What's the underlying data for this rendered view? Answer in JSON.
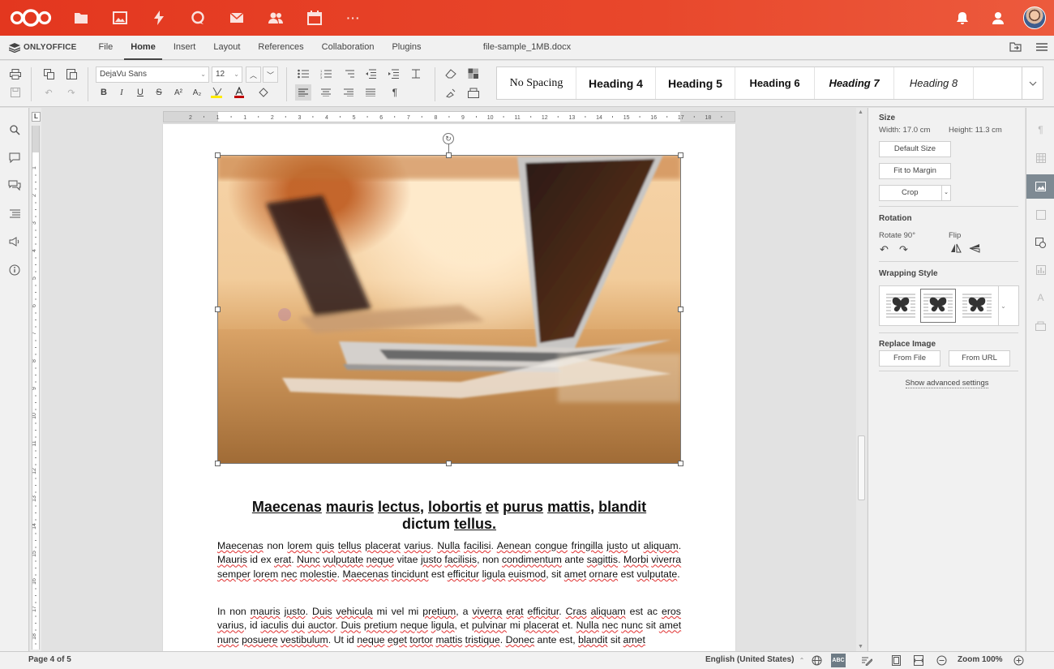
{
  "nextcloud": {
    "apps": [
      "files-icon",
      "photos-icon",
      "activity-icon",
      "talk-icon",
      "mail-icon",
      "contacts-icon",
      "calendar-icon",
      "more-apps-icon"
    ],
    "more_label": "···"
  },
  "editor": {
    "brand": "ONLYOFFICE",
    "menu_tabs": [
      "File",
      "Home",
      "Insert",
      "Layout",
      "References",
      "Collaboration",
      "Plugins"
    ],
    "active_tab": "Home",
    "filename": "file-sample_1MB.docx"
  },
  "toolbar": {
    "font_name": "DejaVu Sans",
    "font_size": "12",
    "styles": [
      "No Spacing",
      "Heading 4",
      "Heading 5",
      "Heading 6",
      "Heading 7",
      "Heading 8"
    ]
  },
  "document": {
    "heading_words": [
      "Maecenas",
      "mauris",
      "lectus,",
      "lobortis",
      "et",
      "purus",
      "mattis,",
      "blandit",
      "dictum",
      "tellus."
    ],
    "paragraph1": "Maecenas non lorem quis tellus placerat varius. Nulla facilisi. Aenean congue fringilla justo ut aliquam. Mauris id ex erat. Nunc vulputate neque vitae justo facilisis, non condimentum ante sagittis. Morbi viverra semper lorem nec molestie. Maecenas tincidunt est efficitur ligula euismod, sit amet ornare est vulputate.",
    "paragraph2": "In non mauris justo. Duis vehicula mi vel mi pretium, a viverra erat efficitur. Cras aliquam est ac eros varius, id iaculis dui auctor. Duis pretium neque ligula, et pulvinar mi placerat et. Nulla nec nunc sit amet nunc posuere vestibulum. Ut id neque eget tortor mattis tristique. Donec ante est, blandit sit amet"
  },
  "image_settings": {
    "size_title": "Size",
    "width": "Width: 17.0 cm",
    "height": "Height: 11.3 cm",
    "default_size": "Default Size",
    "fit_to_margin": "Fit to Margin",
    "crop": "Crop",
    "rotation_title": "Rotation",
    "rotate_label": "Rotate 90°",
    "flip_label": "Flip",
    "wrapping_title": "Wrapping Style",
    "replace_title": "Replace Image",
    "from_file": "From File",
    "from_url": "From URL",
    "advanced": "Show advanced settings"
  },
  "status": {
    "page": "Page 4 of 5",
    "language": "English (United States)",
    "zoom": "Zoom 100%"
  },
  "ruler": {
    "h_ticks": [
      "2",
      "1",
      "1",
      "2",
      "3",
      "4",
      "5",
      "6",
      "7",
      "8",
      "9",
      "10",
      "11",
      "12",
      "13",
      "14",
      "15",
      "16",
      "17",
      "18"
    ],
    "v_ticks": [
      "1",
      "2",
      "3",
      "4",
      "5",
      "6",
      "7",
      "8",
      "9",
      "10",
      "11",
      "12",
      "13",
      "14",
      "15",
      "16",
      "17",
      "18"
    ]
  },
  "colors": {
    "nextcloud_brand": "#e3371f",
    "spellcheck": "#e03030",
    "active_panel": "#7e8a93"
  }
}
